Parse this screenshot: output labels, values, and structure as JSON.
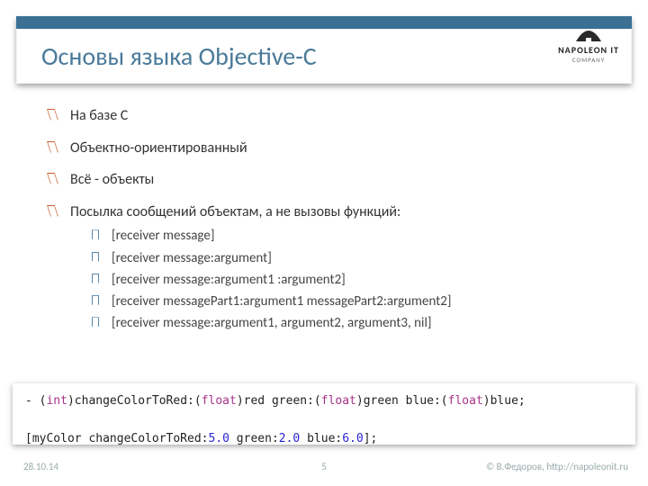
{
  "title": "Основы языка Objective-C",
  "logo": {
    "name": "NAPOLEON IT",
    "sub": "COMPANY"
  },
  "bullets": [
    {
      "text": "На базе С"
    },
    {
      "text": "Объектно-ориентированный"
    },
    {
      "text": "Всё - объекты"
    },
    {
      "text": "Посылка сообщений объектам, а не вызовы функций:",
      "sub": [
        "[receiver message]",
        "[receiver message:argument]",
        "[receiver message:argument1 :argument2]",
        "[receiver messagePart1:argument1 messagePart2:argument2]",
        "[receiver message:argument1, argument2, argument3, nil]"
      ]
    }
  ],
  "code": {
    "decl_prefix": "- (",
    "decl_ret": "int",
    "decl_mid1": ")changeColorToRed:(",
    "decl_t1": "float",
    "decl_mid2": ")red green:(",
    "decl_t2": "float",
    "decl_mid3": ")green blue:(",
    "decl_t3": "float",
    "decl_suffix": ")blue;",
    "call_prefix": "[myColor changeColorToRed:",
    "call_v1": "5.0",
    "call_mid1": " green:",
    "call_v2": "2.0",
    "call_mid2": " blue:",
    "call_v3": "6.0",
    "call_suffix": "];"
  },
  "footer": {
    "date": "28.10.14",
    "page": "5",
    "copyright": "© В.Федоров, http://napoleonit.ru"
  }
}
